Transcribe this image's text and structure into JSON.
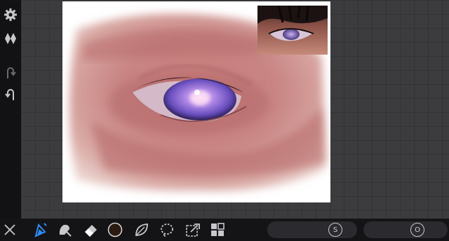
{
  "app": {
    "accent_color": "#2e8cf5",
    "icon_color": "#c8c8cc"
  },
  "left_rail": {
    "items": [
      {
        "icon": "gear-icon"
      },
      {
        "icon": "layers-diamond-icon"
      },
      {
        "icon": "undo-icon"
      },
      {
        "icon": "redo-icon"
      }
    ]
  },
  "canvas": {
    "subject": "painting",
    "reference_image": "reference-photo"
  },
  "toolbar": {
    "tools": [
      {
        "icon": "close-icon"
      },
      {
        "icon": "brush-icon",
        "selected": true
      },
      {
        "icon": "smudge-icon"
      },
      {
        "icon": "eraser-icon"
      },
      {
        "icon": "color-swatch",
        "color": "#2a1a10"
      },
      {
        "icon": "leaf-icon"
      },
      {
        "icon": "lasso-selection-icon"
      },
      {
        "icon": "transform-icon"
      },
      {
        "icon": "layers-grid-icon"
      }
    ],
    "size_slider": {
      "knob_label": "S"
    },
    "opacity_slider": {
      "knob_label": "O"
    }
  }
}
